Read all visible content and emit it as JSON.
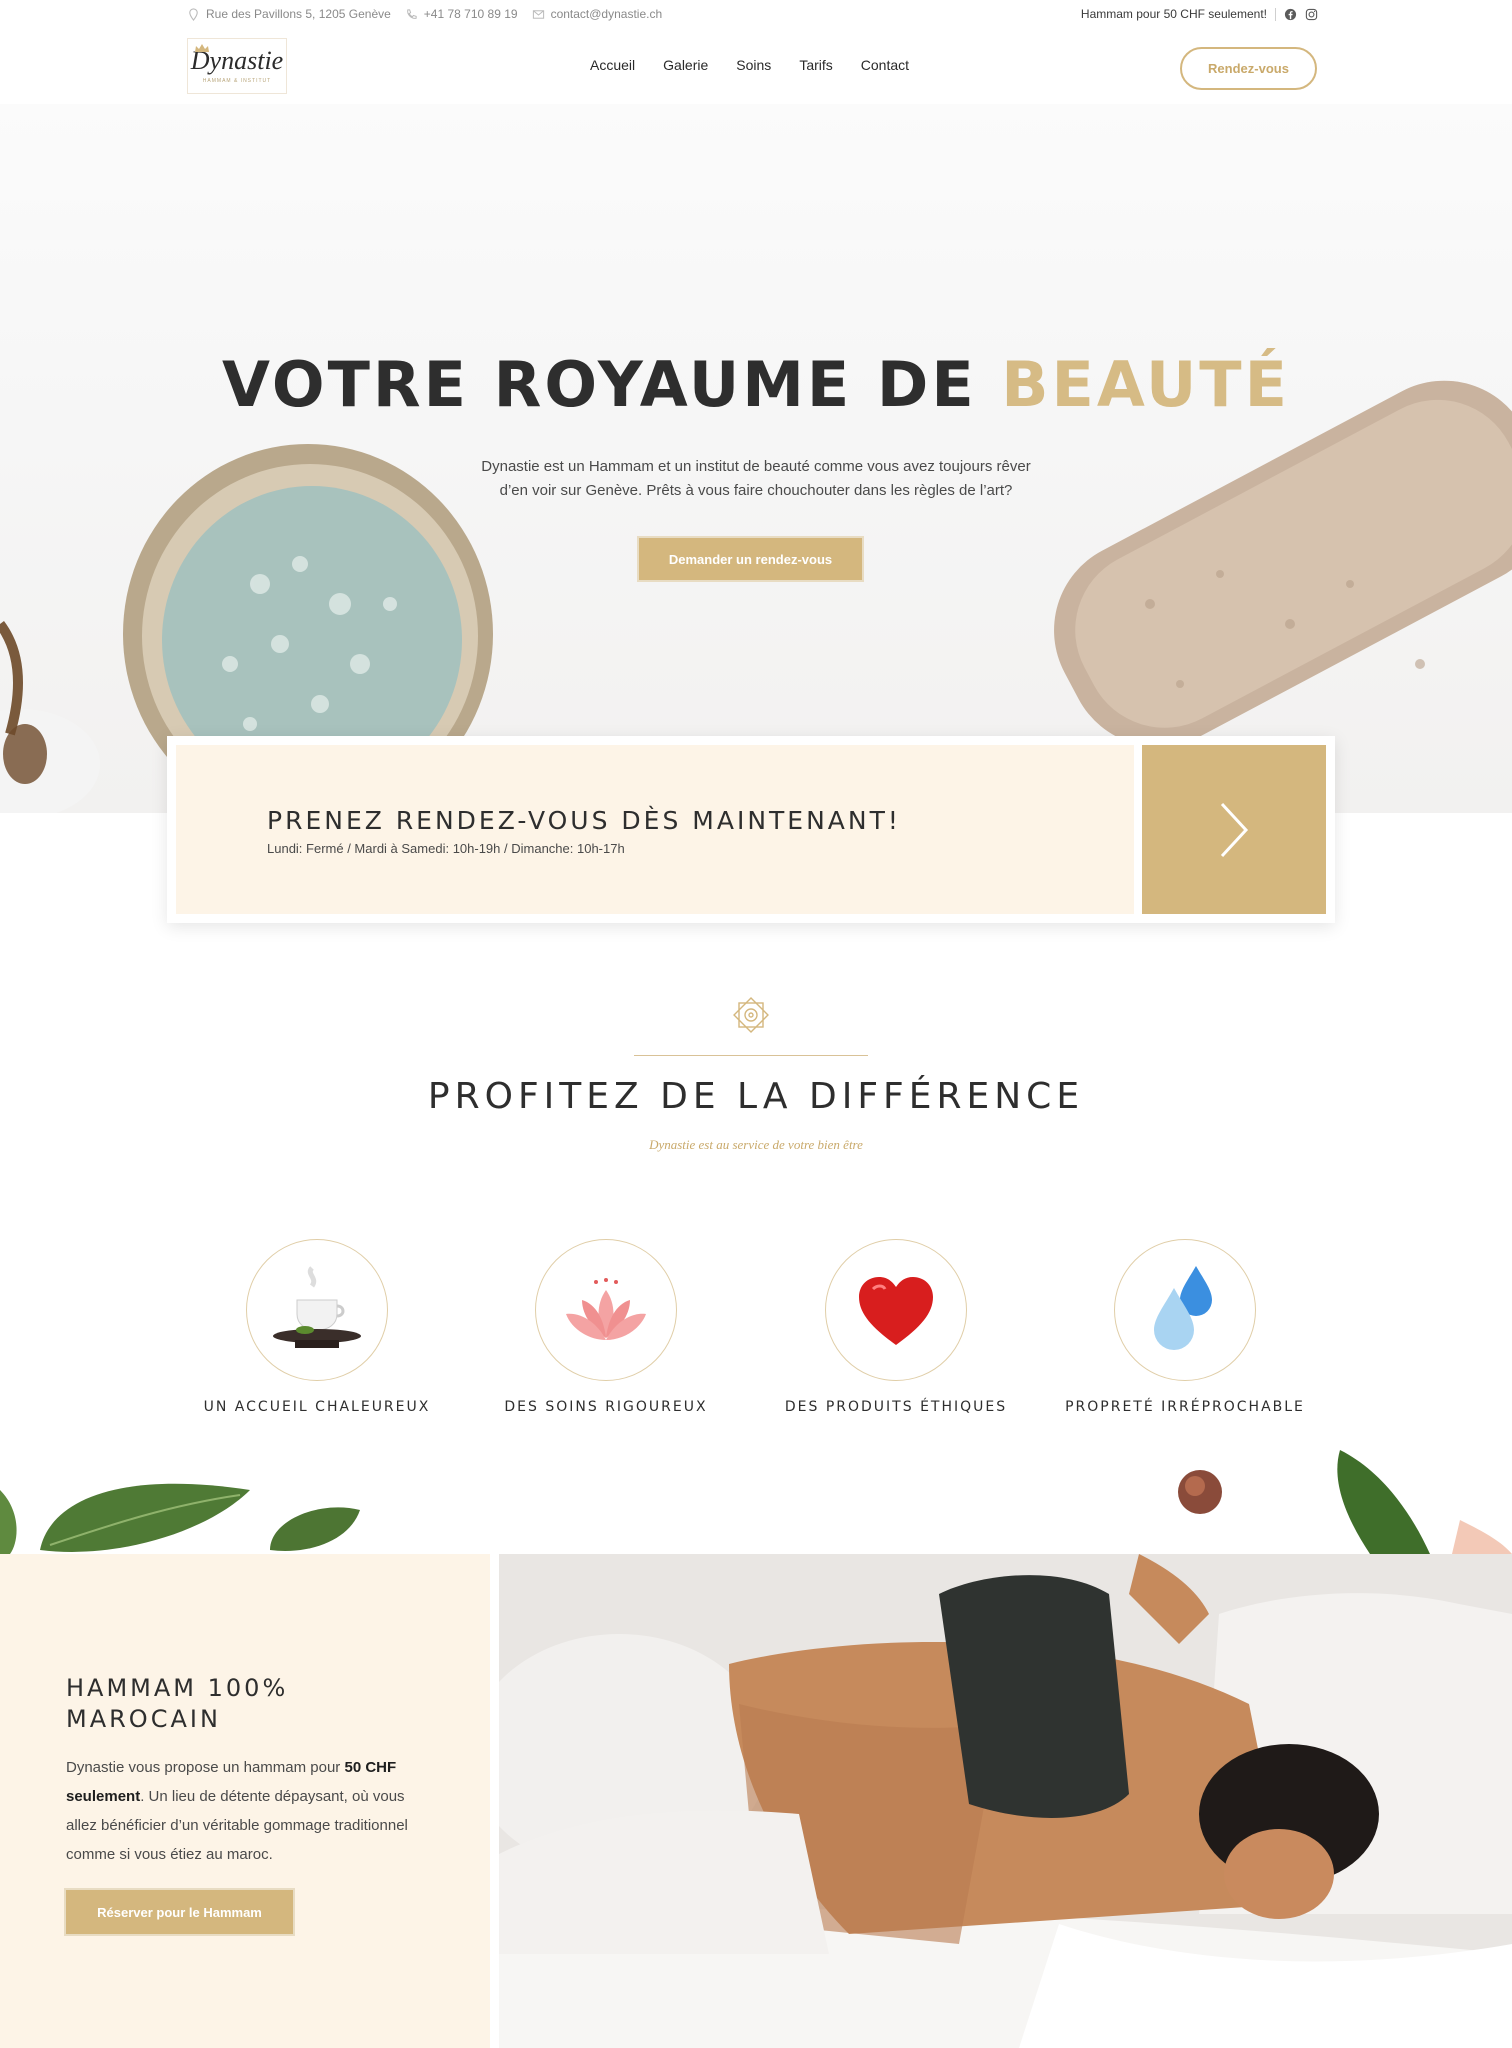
{
  "topbar": {
    "address": "Rue des Pavillons 5, 1205 Genève",
    "phone": "+41 78 710 89 19",
    "email": "contact@dynastie.ch",
    "promo": "Hammam pour 50 CHF seulement!",
    "icons": [
      "location-icon",
      "phone-icon",
      "mail-icon",
      "facebook-icon",
      "instagram-icon"
    ]
  },
  "header": {
    "logo_text": "Dynastie",
    "logo_tagline": "HAMMAM & INSTITUT",
    "nav": [
      "Accueil",
      "Galerie",
      "Soins",
      "Tarifs",
      "Contact"
    ],
    "cta": "Rendez-vous"
  },
  "hero": {
    "title_main": "VOTRE ROYAUME DE",
    "title_accent": "BEAUTÉ",
    "text_line1": "Dynastie est un Hammam et un institut de beauté comme vous avez toujours rêver",
    "text_line2": "d’en voir sur Genève. Prêts à vous faire chouchouter dans les règles de l’art?",
    "button": "Demander un rendez-vous"
  },
  "appointment": {
    "title": "PRENEZ RENDEZ-VOUS DÈS MAINTENANT!",
    "hours": "Lundi: Fermé / Mardi à Samedi: 10h-19h / Dimanche: 10h-17h"
  },
  "difference": {
    "title": "PROFITEZ DE LA DIFFÉRENCE",
    "subtitle": "Dynastie est au service de votre bien être",
    "features": [
      {
        "label": "UN ACCUEIL CHALEUREUX",
        "icon": "tea-cup-icon"
      },
      {
        "label": "DES SOINS RIGOUREUX",
        "icon": "lotus-icon"
      },
      {
        "label": "DES PRODUITS ÉTHIQUES",
        "icon": "heart-icon"
      },
      {
        "label": "PROPRETÉ IRRÉPROCHABLE",
        "icon": "water-drop-icon"
      }
    ]
  },
  "hammam": {
    "title": "HAMMAM 100% MAROCAIN",
    "desc_before": "Dynastie vous propose un hammam pour ",
    "desc_bold": "50 CHF seulement",
    "desc_after": ". Un lieu de détente dépaysant, où vous allez bénéficier d’un véritable gommage traditionnel comme si vous étiez au maroc.",
    "button": "Réserver pour le Hammam"
  },
  "colors": {
    "gold": "#d4b77e",
    "cream": "#fdf4e7",
    "dark": "#2e2e2e"
  }
}
